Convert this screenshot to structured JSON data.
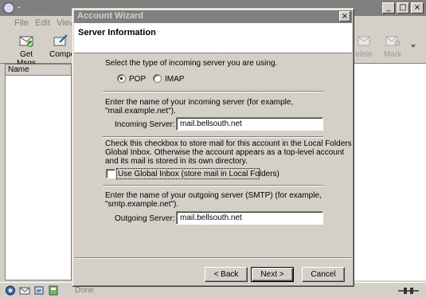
{
  "app": {
    "title": "-",
    "window_buttons": [
      "_",
      "□",
      "×"
    ],
    "menu": [
      "File",
      "Edit",
      "View"
    ],
    "toolbar": {
      "get_msgs": "Get Msgs",
      "compose": "Compo",
      "delete": "elete",
      "mark": "Mark"
    },
    "sidebar_header": "Name",
    "status_text": "Done"
  },
  "dialog": {
    "title": "Account Wizard",
    "close": "×",
    "header_title": "Server Information",
    "incoming_type_prompt": "Select the type of incoming server you are using.",
    "server_types": [
      {
        "label": "POP",
        "selected": true
      },
      {
        "label": "IMAP",
        "selected": false
      }
    ],
    "incoming_prompt_line1": "Enter the name of your incoming server (for example,",
    "incoming_prompt_line2": "\"mail.example.net\").",
    "incoming_label": "Incoming Server:",
    "incoming_value": "mail.bellsouth.net",
    "global_inbox_line1": "Check this checkbox to store mail for this account in the Local Folders",
    "global_inbox_line2": "Global Inbox. Otherwise the account appears as a top-level account",
    "global_inbox_line3": "and its mail is stored in its own directory.",
    "global_inbox_label": "Use Global Inbox (store mail in Local Folders)",
    "global_inbox_checked": false,
    "outgoing_prompt_line1": "Enter the name of your outgoing server (SMTP) (for example,",
    "outgoing_prompt_line2": "\"smtp.example.net\").",
    "outgoing_label": "Outgoing Server:",
    "outgoing_value": "mail.bellsouth.net",
    "buttons": {
      "back": "< Back",
      "next": "Next >",
      "cancel": "Cancel"
    }
  }
}
